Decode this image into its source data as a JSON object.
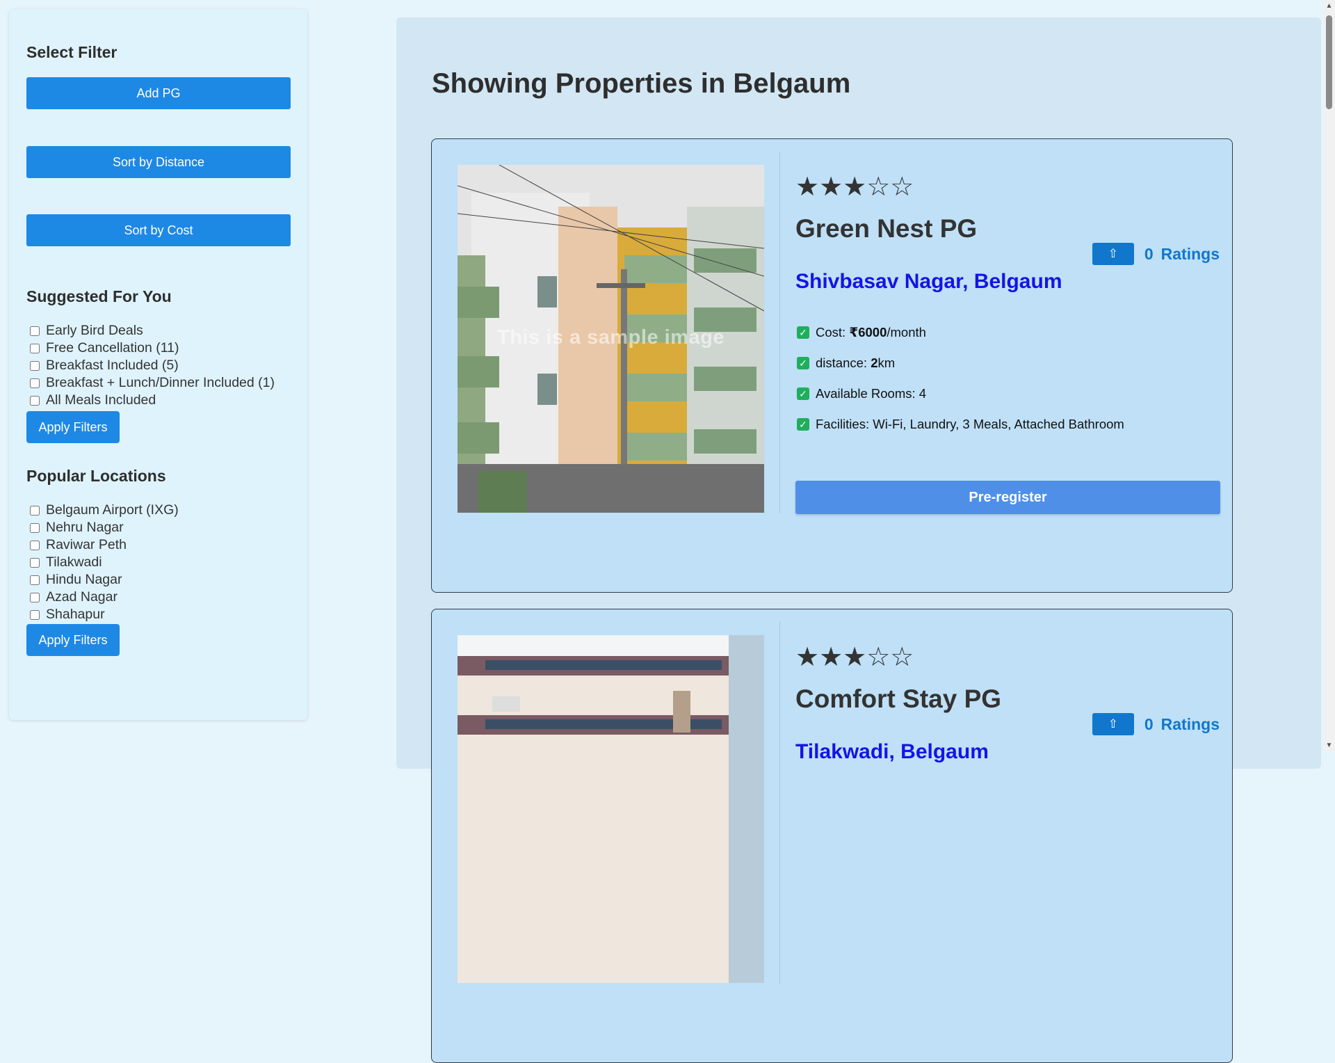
{
  "sidebar": {
    "heading": "Select Filter",
    "add_pg": "Add PG",
    "sort_distance": "Sort by Distance",
    "sort_cost": "Sort by Cost",
    "suggested_heading": "Suggested For You",
    "suggested": [
      {
        "label": "Early Bird Deals"
      },
      {
        "label": "Free Cancellation (11)"
      },
      {
        "label": "Breakfast Included (5)"
      },
      {
        "label": "Breakfast + Lunch/Dinner Included (1)"
      },
      {
        "label": "All Meals Included"
      }
    ],
    "apply_label": "Apply Filters",
    "popular_heading": "Popular Locations",
    "locations": [
      {
        "label": "Belgaum Airport (IXG)"
      },
      {
        "label": "Nehru Nagar"
      },
      {
        "label": "Raviwar Peth"
      },
      {
        "label": "Tilakwadi"
      },
      {
        "label": "Hindu Nagar"
      },
      {
        "label": "Azad Nagar"
      },
      {
        "label": "Shahapur"
      }
    ]
  },
  "main": {
    "title": "Showing Properties in Belgaum",
    "cards": [
      {
        "stars": "★★★☆☆",
        "rating_value": 3,
        "name": "Green Nest PG",
        "location": "Shivbasav Nagar, Belgaum",
        "upvote_icon": "⇧",
        "rating_count": "0",
        "rating_label": "Ratings",
        "watermark": "This is a sample image",
        "cost_prefix": "Cost: ",
        "cost_value": "₹6000",
        "cost_suffix": "/month",
        "distance_prefix": "distance: ",
        "distance_value": "2",
        "distance_suffix": " km",
        "rooms": "Available Rooms: 4",
        "facilities": "Facilities: Wi-Fi, Laundry, 3 Meals, Attached Bathroom",
        "preregister": "Pre-register"
      },
      {
        "stars": "★★★☆☆",
        "rating_value": 3,
        "name": "Comfort Stay PG",
        "location": "Tilakwadi, Belgaum",
        "upvote_icon": "⇧",
        "rating_count": "0",
        "rating_label": "Ratings"
      }
    ]
  },
  "colors": {
    "accent": "#1e88e5",
    "location_link": "#1414e6",
    "rating_blue": "#1177cc",
    "check_green": "#1fae5b",
    "preregister": "#4f8fe8"
  }
}
